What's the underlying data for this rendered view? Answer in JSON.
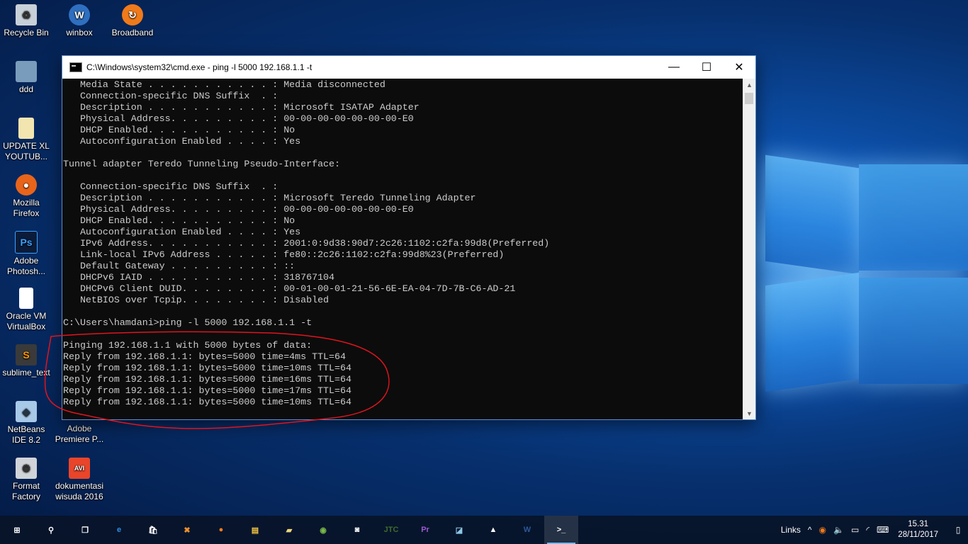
{
  "desktop": {
    "icons": [
      {
        "label": "Recycle Bin",
        "icon": "recycle-bin-icon"
      },
      {
        "label": "winbox",
        "icon": "winbox-icon"
      },
      {
        "label": "Broadband",
        "icon": "broadband-icon"
      },
      {
        "label": "ddd",
        "icon": "image-file-icon"
      },
      {
        "label": "UPDATE XL YOUTUB...",
        "icon": "file-icon"
      },
      {
        "label": "Mozilla Firefox",
        "icon": "firefox-icon"
      },
      {
        "label": "Adobe Photosh...",
        "icon": "photoshop-icon"
      },
      {
        "label": "Oracle VM VirtualBox",
        "icon": "document-icon"
      },
      {
        "label": "sublime_text",
        "icon": "sublime-icon"
      },
      {
        "label": "NetBeans IDE 8.2",
        "icon": "netbeans-icon"
      },
      {
        "label": "Adobe Premiere P...",
        "icon": "premiere-icon"
      },
      {
        "label": "Format Factory",
        "icon": "format-factory-icon"
      },
      {
        "label": "dokumentasi wisuda 2016",
        "icon": "avi-file-icon",
        "badge": "AVI"
      }
    ]
  },
  "cmd": {
    "title": "C:\\Windows\\system32\\cmd.exe - ping  -l 5000 192.168.1.1 -t",
    "controls": {
      "minimize": "—",
      "maximize": "☐",
      "close": "✕"
    },
    "output": "   Media State . . . . . . . . . . . : Media disconnected\n   Connection-specific DNS Suffix  . :\n   Description . . . . . . . . . . . : Microsoft ISATAP Adapter\n   Physical Address. . . . . . . . . : 00-00-00-00-00-00-00-E0\n   DHCP Enabled. . . . . . . . . . . : No\n   Autoconfiguration Enabled . . . . : Yes\n\nTunnel adapter Teredo Tunneling Pseudo-Interface:\n\n   Connection-specific DNS Suffix  . :\n   Description . . . . . . . . . . . : Microsoft Teredo Tunneling Adapter\n   Physical Address. . . . . . . . . : 00-00-00-00-00-00-00-E0\n   DHCP Enabled. . . . . . . . . . . : No\n   Autoconfiguration Enabled . . . . : Yes\n   IPv6 Address. . . . . . . . . . . : 2001:0:9d38:90d7:2c26:1102:c2fa:99d8(Preferred)\n   Link-local IPv6 Address . . . . . : fe80::2c26:1102:c2fa:99d8%23(Preferred)\n   Default Gateway . . . . . . . . . : ::\n   DHCPv6 IAID . . . . . . . . . . . : 318767104\n   DHCPv6 Client DUID. . . . . . . . : 00-01-00-01-21-56-6E-EA-04-7D-7B-C6-AD-21\n   NetBIOS over Tcpip. . . . . . . . : Disabled\n\nC:\\Users\\hamdani>ping -l 5000 192.168.1.1 -t\n\nPinging 192.168.1.1 with 5000 bytes of data:\nReply from 192.168.1.1: bytes=5000 time=4ms TTL=64\nReply from 192.168.1.1: bytes=5000 time=10ms TTL=64\nReply from 192.168.1.1: bytes=5000 time=16ms TTL=64\nReply from 192.168.1.1: bytes=5000 time=17ms TTL=64\nReply from 192.168.1.1: bytes=5000 time=10ms TTL=64",
    "annotation_color": "#e0141e"
  },
  "taskbar": {
    "apps": [
      {
        "name": "start-button",
        "glyph": "⊞",
        "color": "#ffffff"
      },
      {
        "name": "search-icon",
        "glyph": "⚲",
        "color": "#ffffff"
      },
      {
        "name": "task-view-icon",
        "glyph": "❐",
        "color": "#ffffff"
      },
      {
        "name": "edge-icon",
        "glyph": "e",
        "color": "#2f8fe8"
      },
      {
        "name": "store-icon",
        "glyph": "🛍",
        "color": "#ffffff"
      },
      {
        "name": "xampp-icon",
        "glyph": "✖",
        "color": "#f2902b"
      },
      {
        "name": "firefox-icon",
        "glyph": "●",
        "color": "#ff7b1c"
      },
      {
        "name": "file-explorer-icon",
        "glyph": "▤",
        "color": "#f4c542"
      },
      {
        "name": "folder-icon",
        "glyph": "▰",
        "color": "#f0d67a"
      },
      {
        "name": "android-studio-icon",
        "glyph": "◉",
        "color": "#79b84a"
      },
      {
        "name": "camera-icon",
        "glyph": "◙",
        "color": "#ffffff"
      },
      {
        "name": "jtc-icon",
        "glyph": "JTC",
        "color": "#3d6b2f"
      },
      {
        "name": "premiere-icon",
        "glyph": "Pr",
        "color": "#9b59d0"
      },
      {
        "name": "notepad-icon",
        "glyph": "◪",
        "color": "#8ec8e8"
      },
      {
        "name": "photos-icon",
        "glyph": "▲",
        "color": "#ffffff"
      },
      {
        "name": "word-icon",
        "glyph": "W",
        "color": "#2b5797"
      },
      {
        "name": "cmd-icon",
        "glyph": ">_",
        "color": "#ffffff"
      }
    ],
    "tray": {
      "links_label": "Links",
      "chevron": "^",
      "time": "15.31",
      "date": "28/11/2017"
    }
  }
}
